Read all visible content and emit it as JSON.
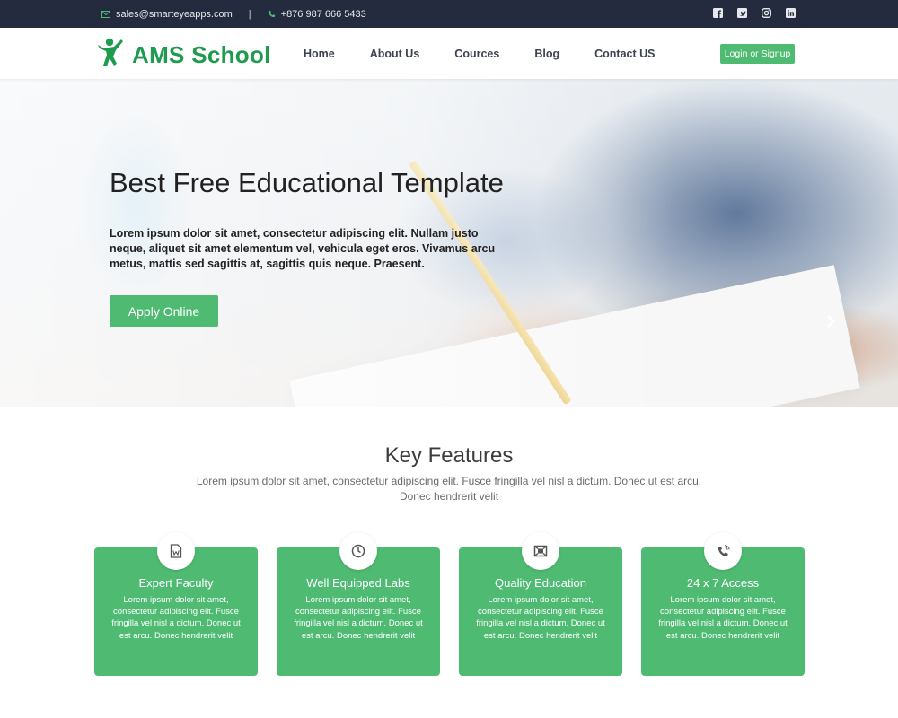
{
  "topbar": {
    "email": "sales@smarteyeapps.com",
    "separator": "|",
    "phone": "+876 987 666 5433",
    "social_icons": [
      "facebook-icon",
      "twitter-icon",
      "instagram-icon",
      "linkedin-icon"
    ]
  },
  "header": {
    "logo_text": "AMS School",
    "nav": [
      "Home",
      "About Us",
      "Cources",
      "Blog",
      "Contact US"
    ],
    "login_label": "Login or Signup"
  },
  "hero": {
    "title": "Best Free Educational Template",
    "text": "Lorem ipsum dolor sit amet, consectetur adipiscing elit. Nullam justo neque, aliquet sit amet elementum vel, vehicula eget eros. Vivamus arcu metus, mattis sed sagittis at, sagittis quis neque. Praesent.",
    "apply_label": "Apply Online"
  },
  "features": {
    "title": "Key Features",
    "subtitle": "Lorem ipsum dolor sit amet, consectetur adipiscing elit. Fusce fringilla vel nisl a dictum. Donec ut est arcu. Donec hendrerit velit",
    "cards": [
      {
        "title": "Expert Faculty",
        "icon": "document-icon",
        "text": "Lorem ipsum dolor sit amet, consectetur adipiscing elit. Fusce fringilla vel nisl a dictum. Donec ut est arcu. Donec hendrerit velit"
      },
      {
        "title": "Well Equipped Labs",
        "icon": "clock-icon",
        "text": "Lorem ipsum dolor sit amet, consectetur adipiscing elit. Fusce fringilla vel nisl a dictum. Donec ut est arcu. Donec hendrerit velit"
      },
      {
        "title": "Quality Education",
        "icon": "image-frame-icon",
        "text": "Lorem ipsum dolor sit amet, consectetur adipiscing elit. Fusce fringilla vel nisl a dictum. Donec ut est arcu. Donec hendrerit velit"
      },
      {
        "title": "24 x 7 Access",
        "icon": "phone-icon",
        "text": "Lorem ipsum dolor sit amet, consectetur adipiscing elit. Fusce fringilla vel nisl a dictum. Donec ut est arcu. Donec hendrerit velit"
      }
    ]
  },
  "colors": {
    "accent": "#4fbb72",
    "brand": "#1f9b4f",
    "topbar": "#242b3e"
  }
}
